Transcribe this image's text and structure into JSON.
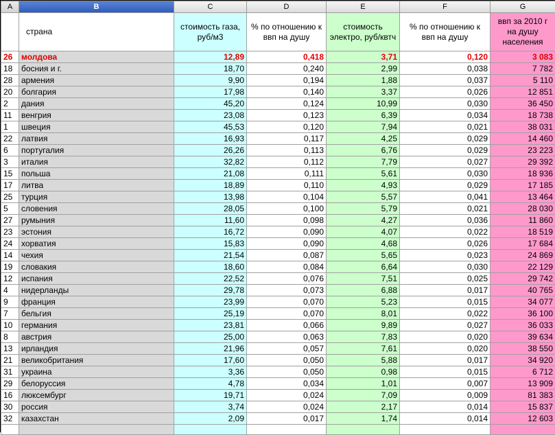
{
  "column_letters": [
    "A",
    "B",
    "C",
    "D",
    "E",
    "F",
    "G"
  ],
  "header": {
    "country": "страна",
    "gas_cost": "стоимость газа, руб/м3",
    "gas_pct": "% по отношению к ввп на душу",
    "el_cost": "стоимость электро, руб/квтч",
    "el_pct": "% по отношению к ввп на душу",
    "gdp": "ввп за 2010 г на душу населения"
  },
  "colors": {
    "gas_column": "#ccffff",
    "electricity_column": "#ccffcc",
    "gdp_column": "#ff99cc",
    "country_column": "#d9d9d9",
    "highlight_text": "#e00000",
    "selected_column_header": "#2f5bb8"
  },
  "selected_column": "B",
  "rows": [
    {
      "rank": "26",
      "country": "молдова",
      "gas": "12,89",
      "gas_pct": "0,418",
      "el": "3,71",
      "el_pct": "0,120",
      "gdp": "3 083",
      "highlight": true
    },
    {
      "rank": "18",
      "country": "босния и г.",
      "gas": "18,70",
      "gas_pct": "0,240",
      "el": "2,99",
      "el_pct": "0,038",
      "gdp": "7 782"
    },
    {
      "rank": "28",
      "country": "армения",
      "gas": "9,90",
      "gas_pct": "0,194",
      "el": "1,88",
      "el_pct": "0,037",
      "gdp": "5 110"
    },
    {
      "rank": "20",
      "country": "болгария",
      "gas": "17,98",
      "gas_pct": "0,140",
      "el": "3,37",
      "el_pct": "0,026",
      "gdp": "12 851"
    },
    {
      "rank": "2",
      "country": "дания",
      "gas": "45,20",
      "gas_pct": "0,124",
      "el": "10,99",
      "el_pct": "0,030",
      "gdp": "36 450"
    },
    {
      "rank": "11",
      "country": "венгрия",
      "gas": "23,08",
      "gas_pct": "0,123",
      "el": "6,39",
      "el_pct": "0,034",
      "gdp": "18 738"
    },
    {
      "rank": "1",
      "country": "швеция",
      "gas": "45,53",
      "gas_pct": "0,120",
      "el": "7,94",
      "el_pct": "0,021",
      "gdp": "38 031"
    },
    {
      "rank": "22",
      "country": "латвия",
      "gas": "16,93",
      "gas_pct": "0,117",
      "el": "4,25",
      "el_pct": "0,029",
      "gdp": "14 460"
    },
    {
      "rank": "6",
      "country": "португалия",
      "gas": "26,26",
      "gas_pct": "0,113",
      "el": "6,76",
      "el_pct": "0,029",
      "gdp": "23 223"
    },
    {
      "rank": "3",
      "country": "италия",
      "gas": "32,82",
      "gas_pct": "0,112",
      "el": "7,79",
      "el_pct": "0,027",
      "gdp": "29 392"
    },
    {
      "rank": "15",
      "country": "польша",
      "gas": "21,08",
      "gas_pct": "0,111",
      "el": "5,61",
      "el_pct": "0,030",
      "gdp": "18 936"
    },
    {
      "rank": "17",
      "country": "литва",
      "gas": "18,89",
      "gas_pct": "0,110",
      "el": "4,93",
      "el_pct": "0,029",
      "gdp": "17 185"
    },
    {
      "rank": "25",
      "country": "турция",
      "gas": "13,98",
      "gas_pct": "0,104",
      "el": "5,57",
      "el_pct": "0,041",
      "gdp": "13 464"
    },
    {
      "rank": "5",
      "country": "словения",
      "gas": "28,05",
      "gas_pct": "0,100",
      "el": "5,79",
      "el_pct": "0,021",
      "gdp": "28 030"
    },
    {
      "rank": "27",
      "country": "румыния",
      "gas": "11,60",
      "gas_pct": "0,098",
      "el": "4,27",
      "el_pct": "0,036",
      "gdp": "11 860"
    },
    {
      "rank": "23",
      "country": "эстония",
      "gas": "16,72",
      "gas_pct": "0,090",
      "el": "4,07",
      "el_pct": "0,022",
      "gdp": "18 519"
    },
    {
      "rank": "24",
      "country": "хорватия",
      "gas": "15,83",
      "gas_pct": "0,090",
      "el": "4,68",
      "el_pct": "0,026",
      "gdp": "17 684"
    },
    {
      "rank": "14",
      "country": "чехия",
      "gas": "21,54",
      "gas_pct": "0,087",
      "el": "5,65",
      "el_pct": "0,023",
      "gdp": "24 869"
    },
    {
      "rank": "19",
      "country": "словакия",
      "gas": "18,60",
      "gas_pct": "0,084",
      "el": "6,64",
      "el_pct": "0,030",
      "gdp": "22 129"
    },
    {
      "rank": "12",
      "country": "испания",
      "gas": "22,52",
      "gas_pct": "0,076",
      "el": "7,51",
      "el_pct": "0,025",
      "gdp": "29 742"
    },
    {
      "rank": "4",
      "country": "нидерланды",
      "gas": "29,78",
      "gas_pct": "0,073",
      "el": "6,88",
      "el_pct": "0,017",
      "gdp": "40 765"
    },
    {
      "rank": "9",
      "country": "франция",
      "gas": "23,99",
      "gas_pct": "0,070",
      "el": "5,23",
      "el_pct": "0,015",
      "gdp": "34 077"
    },
    {
      "rank": "7",
      "country": "бельгия",
      "gas": "25,19",
      "gas_pct": "0,070",
      "el": "8,01",
      "el_pct": "0,022",
      "gdp": "36 100"
    },
    {
      "rank": "10",
      "country": "германия",
      "gas": "23,81",
      "gas_pct": "0,066",
      "el": "9,89",
      "el_pct": "0,027",
      "gdp": "36 033"
    },
    {
      "rank": "8",
      "country": "австрия",
      "gas": "25,00",
      "gas_pct": "0,063",
      "el": "7,83",
      "el_pct": "0,020",
      "gdp": "39 634"
    },
    {
      "rank": "13",
      "country": "ирландия",
      "gas": "21,96",
      "gas_pct": "0,057",
      "el": "7,61",
      "el_pct": "0,020",
      "gdp": "38 550"
    },
    {
      "rank": "21",
      "country": "великобритания",
      "gas": "17,60",
      "gas_pct": "0,050",
      "el": "5,88",
      "el_pct": "0,017",
      "gdp": "34 920"
    },
    {
      "rank": "31",
      "country": "украина",
      "gas": "3,36",
      "gas_pct": "0,050",
      "el": "0,98",
      "el_pct": "0,015",
      "gdp": "6 712"
    },
    {
      "rank": "29",
      "country": "белоруссия",
      "gas": "4,78",
      "gas_pct": "0,034",
      "el": "1,01",
      "el_pct": "0,007",
      "gdp": "13 909"
    },
    {
      "rank": "16",
      "country": "люксембург",
      "gas": "19,71",
      "gas_pct": "0,024",
      "el": "7,09",
      "el_pct": "0,009",
      "gdp": "81 383"
    },
    {
      "rank": "30",
      "country": "россия",
      "gas": "3,74",
      "gas_pct": "0,024",
      "el": "2,17",
      "el_pct": "0,014",
      "gdp": "15 837"
    },
    {
      "rank": "32",
      "country": "казахстан",
      "gas": "2,09",
      "gas_pct": "0,017",
      "el": "1,74",
      "el_pct": "0,014",
      "gdp": "12 603"
    }
  ]
}
